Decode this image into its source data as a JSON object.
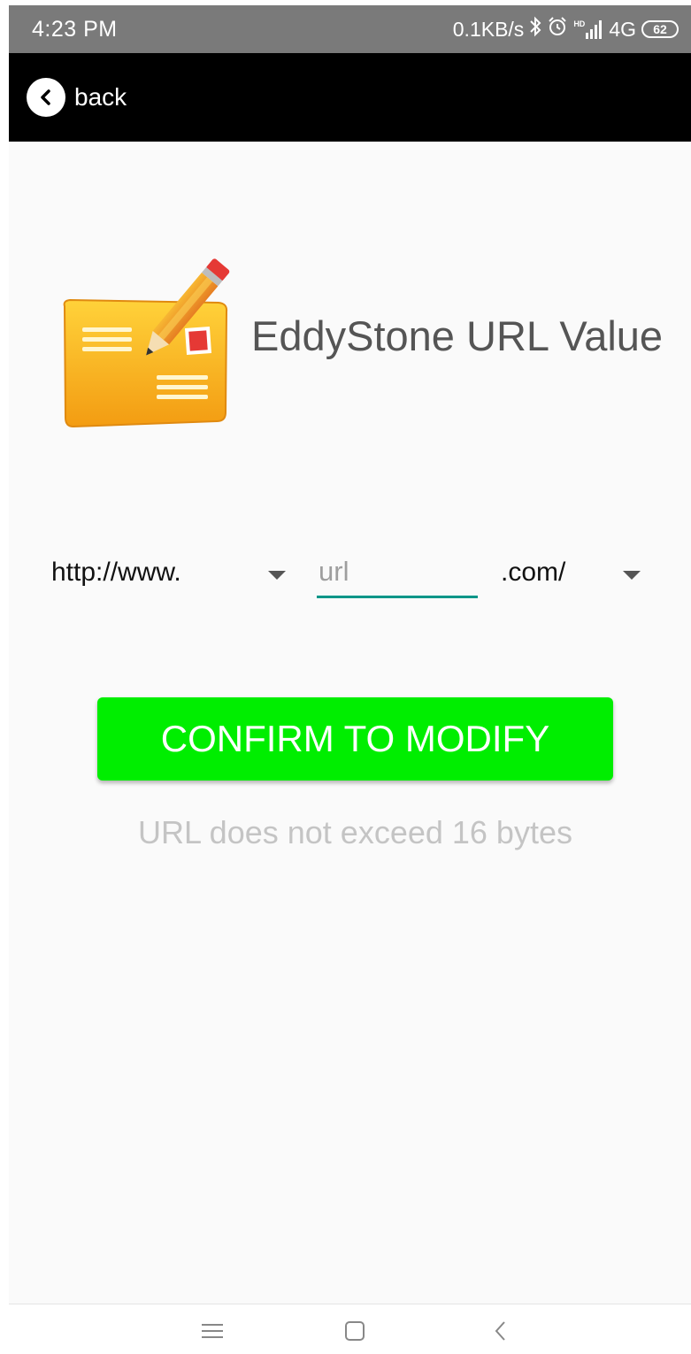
{
  "status_bar": {
    "time": "4:23 PM",
    "net_speed": "0.1KB/s",
    "bluetooth_icon": "bluetooth-icon",
    "alarm_icon": "alarm-clock-icon",
    "hd_label": "HD",
    "signal_icon": "cell-signal-icon",
    "network_type": "4G",
    "battery_level": "62"
  },
  "action_bar": {
    "back_icon": "chevron-left-circle-icon",
    "back_label": "back"
  },
  "header": {
    "icon": "envelope-with-pencil-icon",
    "title": "EddyStone URL Value"
  },
  "url_form": {
    "prefix_selected": "http://www.",
    "url_placeholder": "url",
    "url_value": "",
    "suffix_selected": ".com/",
    "dropdown_icon": "dropdown-arrow-icon"
  },
  "confirm_button": {
    "label": "CONFIRM TO MODIFY",
    "color": "#00ee00"
  },
  "hint": "URL does not exceed 16 bytes",
  "nav_bar": {
    "menu_icon": "menu-icon",
    "home_icon": "home-square-icon",
    "back_icon": "back-chevron-icon"
  },
  "colors": {
    "accent": "#009688",
    "status_bar": "#7a7a7a",
    "action_bar": "#000000"
  }
}
